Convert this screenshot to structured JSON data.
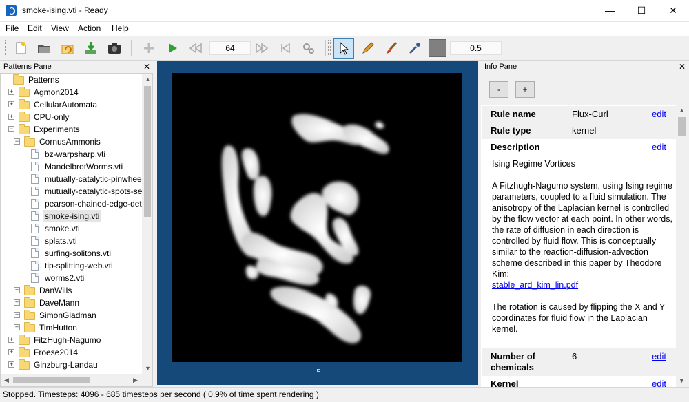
{
  "window": {
    "title": "smoke-ising.vti - Ready",
    "minimize": "—",
    "maximize": "☐",
    "close": "✕"
  },
  "menu": [
    "File",
    "Edit",
    "View",
    "Action",
    "Help"
  ],
  "toolbar": {
    "timestep_value": "64",
    "brush_size_value": "0.5",
    "color_swatch": "#808080"
  },
  "patterns_pane": {
    "title": "Patterns Pane",
    "close": "✕",
    "tree": [
      {
        "label": "Patterns",
        "type": "folder",
        "level": 0,
        "expander": ""
      },
      {
        "label": "Agmon2014",
        "type": "folder",
        "level": 1,
        "expander": "+"
      },
      {
        "label": "CellularAutomata",
        "type": "folder",
        "level": 1,
        "expander": "+"
      },
      {
        "label": "CPU-only",
        "type": "folder",
        "level": 1,
        "expander": "+"
      },
      {
        "label": "Experiments",
        "type": "folder",
        "level": 1,
        "expander": "−"
      },
      {
        "label": "CornusAmmonis",
        "type": "folder",
        "level": 2,
        "expander": "−"
      },
      {
        "label": "bz-warpsharp.vti",
        "type": "file",
        "level": 3
      },
      {
        "label": "MandelbrotWorms.vti",
        "type": "file",
        "level": 3
      },
      {
        "label": "mutually-catalytic-pinwheels",
        "type": "file",
        "level": 3
      },
      {
        "label": "mutually-catalytic-spots-seco",
        "type": "file",
        "level": 3
      },
      {
        "label": "pearson-chained-edge-detec",
        "type": "file",
        "level": 3
      },
      {
        "label": "smoke-ising.vti",
        "type": "file",
        "level": 3,
        "selected": true
      },
      {
        "label": "smoke.vti",
        "type": "file",
        "level": 3
      },
      {
        "label": "splats.vti",
        "type": "file",
        "level": 3
      },
      {
        "label": "surfing-solitons.vti",
        "type": "file",
        "level": 3
      },
      {
        "label": "tip-splitting-web.vti",
        "type": "file",
        "level": 3
      },
      {
        "label": "worms2.vti",
        "type": "file",
        "level": 3
      },
      {
        "label": "DanWills",
        "type": "folder",
        "level": 2,
        "expander": "+"
      },
      {
        "label": "DaveMann",
        "type": "folder",
        "level": 2,
        "expander": "+"
      },
      {
        "label": "SimonGladman",
        "type": "folder",
        "level": 2,
        "expander": "+"
      },
      {
        "label": "TimHutton",
        "type": "folder",
        "level": 2,
        "expander": "+"
      },
      {
        "label": "FitzHugh-Nagumo",
        "type": "folder",
        "level": 1,
        "expander": "+"
      },
      {
        "label": "Froese2014",
        "type": "folder",
        "level": 1,
        "expander": "+"
      },
      {
        "label": "Ginzburg-Landau",
        "type": "folder",
        "level": 1,
        "expander": "+"
      }
    ]
  },
  "info_pane": {
    "title": "Info Pane",
    "close": "✕",
    "minus_btn": "-",
    "plus_btn": "+",
    "rule_name_label": "Rule name",
    "rule_name_value": "Flux-Curl",
    "rule_type_label": "Rule type",
    "rule_type_value": "kernel",
    "description_label": "Description",
    "edit": "edit",
    "desc_title": "Ising Regime Vortices",
    "desc_para1": "A Fitzhugh-Nagumo system, using Ising regime parameters, coupled to a fluid simulation. The anisotropy of the Laplacian kernel is controlled by the flow vector at each point. In other words, the rate of diffusion in each direction is controlled by fluid flow. This is conceptually similar to the reaction-diffusion-advection scheme described in this paper by Theodore Kim:",
    "desc_link": "stable_ard_kim_lin.pdf",
    "desc_para2": "The rotation is caused by flipping the X and Y coordinates for fluid flow in the Laplacian kernel.",
    "num_chem_label": "Number of chemicals",
    "num_chem_value": "6",
    "kernel_label": "Kernel"
  },
  "status": {
    "text": "Stopped. Timesteps: 4096   -   685 timesteps per second    ( 0.9% of time spent rendering )"
  }
}
